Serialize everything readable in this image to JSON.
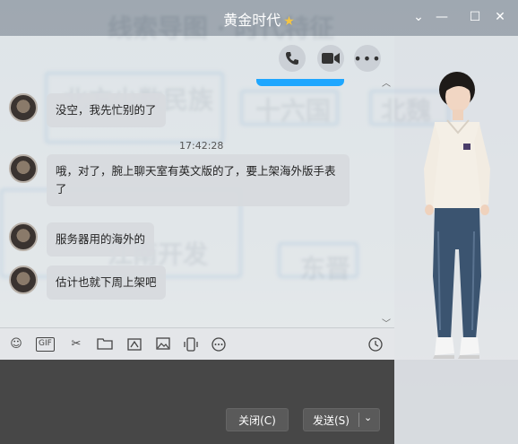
{
  "window": {
    "title": "黄金时代",
    "title_star_icon": "star-icon"
  },
  "window_controls": [
    "chevron-down-icon",
    "minimize-icon",
    "maximize-icon",
    "close-icon"
  ],
  "header_actions": [
    "phone-icon",
    "video-icon",
    "more-icon"
  ],
  "messages": [
    {
      "text": "没空，我先忙别的了"
    },
    {
      "text": "哦，对了，腕上聊天室有英文版的了，要上架海外版手表了"
    },
    {
      "text": "服务器用的海外的"
    },
    {
      "text": "估计也就下周上架吧"
    }
  ],
  "timestamp": "17:42:28",
  "toolbar": {
    "gif_label": "GIF",
    "icons": [
      "emoji-icon",
      "gif-icon",
      "scissors-icon",
      "folder-icon",
      "image-edit-icon",
      "picture-icon",
      "shake-icon",
      "more-circle-icon",
      "history-clock-icon"
    ]
  },
  "buttons": {
    "close_label": "关闭(C)",
    "send_label": "发送(S)"
  },
  "colors": {
    "accent": "#1fa7ff",
    "title_star": "#f5c542",
    "input_bg": "#474747"
  }
}
